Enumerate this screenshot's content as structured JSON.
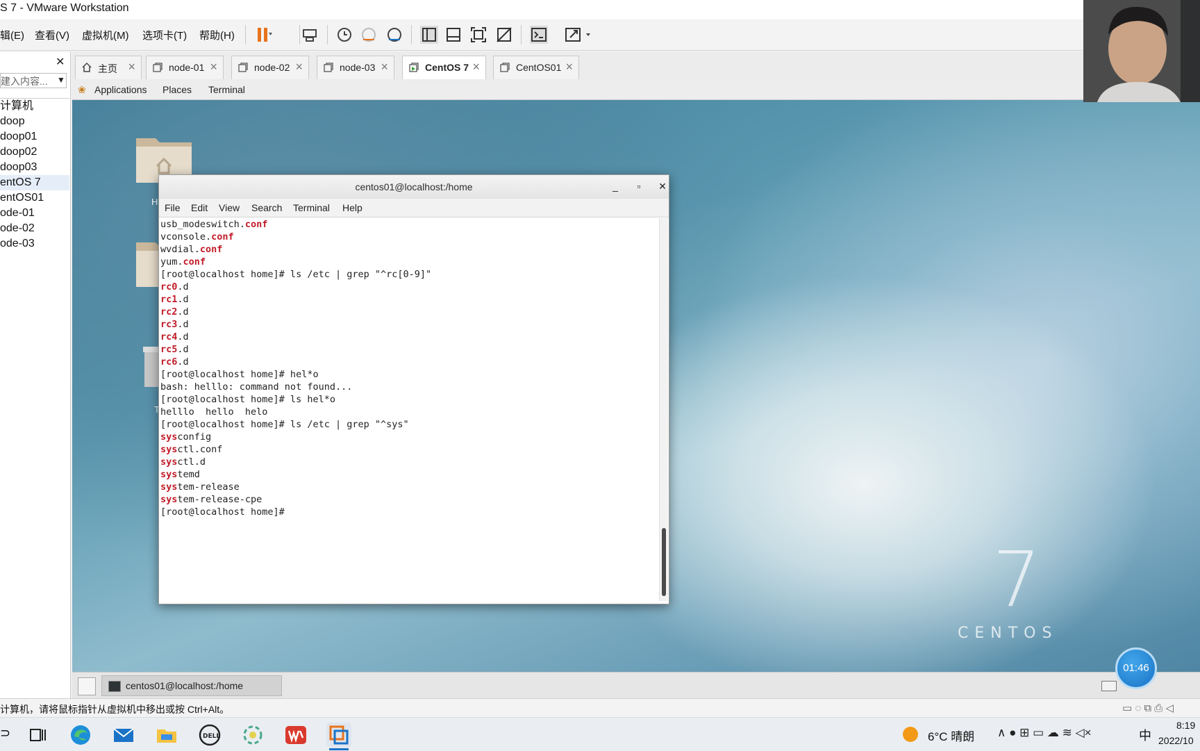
{
  "window": {
    "title": "S 7 - VMware Workstation"
  },
  "menu": [
    {
      "label": "辑(E)"
    },
    {
      "label": "查看(V)"
    },
    {
      "label": "虚拟机(M)"
    },
    {
      "label": "选项卡(T)"
    },
    {
      "label": "帮助(H)"
    }
  ],
  "toolbar": {
    "icons": [
      "pause-icon",
      "send-ctrl-alt-del-icon",
      "snapshot-icon",
      "revert-snapshot-icon",
      "snapshot-manager-icon",
      "library-view-icon",
      "thumbnail-bar-icon",
      "full-screen-icon",
      "unity-icon",
      "console-view-icon",
      "stretch-guest-icon"
    ]
  },
  "library": {
    "close": "✕",
    "search_placeholder": "建入内容...",
    "items": [
      {
        "label": "计算机",
        "selected": false
      },
      {
        "label": "doop",
        "selected": false
      },
      {
        "label": "doop01",
        "selected": false
      },
      {
        "label": "doop02",
        "selected": false
      },
      {
        "label": "doop03",
        "selected": false
      },
      {
        "label": "entOS 7",
        "selected": true
      },
      {
        "label": "entOS01",
        "selected": false
      },
      {
        "label": "ode-01",
        "selected": false
      },
      {
        "label": "ode-02",
        "selected": false
      },
      {
        "label": "ode-03",
        "selected": false
      }
    ]
  },
  "tabs": [
    {
      "label": "主页",
      "icon": "home-icon",
      "active": false
    },
    {
      "label": "node-01",
      "icon": "vm-icon",
      "active": false
    },
    {
      "label": "node-02",
      "icon": "vm-icon",
      "active": false
    },
    {
      "label": "node-03",
      "icon": "vm-icon",
      "active": false
    },
    {
      "label": "CentOS 7",
      "icon": "vm-running-icon",
      "active": true
    },
    {
      "label": "CentOS01",
      "icon": "vm-icon",
      "active": false
    }
  ],
  "guest": {
    "topbar": {
      "applications": "Applications",
      "places": "Places",
      "terminal": "Terminal"
    },
    "desktop_labels": [
      "H",
      "T"
    ],
    "terminal": {
      "title": "centos01@localhost:/home",
      "menu": [
        "File",
        "Edit",
        "View",
        "Search",
        "Terminal",
        "Help"
      ],
      "lines": [
        [
          {
            "t": "usb_modeswitch."
          },
          {
            "t": "conf",
            "hl": true
          }
        ],
        [
          {
            "t": "vconsole."
          },
          {
            "t": "conf",
            "hl": true
          }
        ],
        [
          {
            "t": "wvdial."
          },
          {
            "t": "conf",
            "hl": true
          }
        ],
        [
          {
            "t": "yum."
          },
          {
            "t": "conf",
            "hl": true
          }
        ],
        [
          {
            "t": "[root@localhost home]# ls /etc | grep \"^rc[0-9]\""
          }
        ],
        [
          {
            "t": "rc0",
            "hl": true
          },
          {
            "t": ".d"
          }
        ],
        [
          {
            "t": "rc1",
            "hl": true
          },
          {
            "t": ".d"
          }
        ],
        [
          {
            "t": "rc2",
            "hl": true
          },
          {
            "t": ".d"
          }
        ],
        [
          {
            "t": "rc3",
            "hl": true
          },
          {
            "t": ".d"
          }
        ],
        [
          {
            "t": "rc4",
            "hl": true
          },
          {
            "t": ".d"
          }
        ],
        [
          {
            "t": "rc5",
            "hl": true
          },
          {
            "t": ".d"
          }
        ],
        [
          {
            "t": "rc6",
            "hl": true
          },
          {
            "t": ".d"
          }
        ],
        [
          {
            "t": "[root@localhost home]# hel*o"
          }
        ],
        [
          {
            "t": "bash: helllo: command not found..."
          }
        ],
        [
          {
            "t": "[root@localhost home]# ls hel*o"
          }
        ],
        [
          {
            "t": "helllo  hello  helo"
          }
        ],
        [
          {
            "t": "[root@localhost home]# ls /etc | grep \"^sys\""
          }
        ],
        [
          {
            "t": "sys",
            "hl": true
          },
          {
            "t": "config"
          }
        ],
        [
          {
            "t": "sys",
            "hl": true
          },
          {
            "t": "ctl.conf"
          }
        ],
        [
          {
            "t": "sys",
            "hl": true
          },
          {
            "t": "ctl.d"
          }
        ],
        [
          {
            "t": "sys",
            "hl": true
          },
          {
            "t": "temd"
          }
        ],
        [
          {
            "t": "sys",
            "hl": true
          },
          {
            "t": "tem-release"
          }
        ],
        [
          {
            "t": "sys",
            "hl": true
          },
          {
            "t": "tem-release-cpe"
          }
        ],
        [
          {
            "t": "[root@localhost home]# "
          }
        ]
      ],
      "scroll_position": 0.92
    },
    "brand": {
      "number": "7",
      "word": "CENTOS"
    },
    "taskbar_item": "centos01@localhost:/home"
  },
  "status": {
    "message": "计算机，请将鼠标指针从虚拟机中移出或按 Ctrl+Alt。"
  },
  "recording": {
    "time": "01:46"
  },
  "wintaskbar": {
    "apps": [
      "task-view-icon",
      "edge-icon",
      "mail-icon",
      "file-explorer-icon",
      "dell-icon",
      "pinwheel-icon",
      "wps-icon",
      "vmware-icon"
    ],
    "weather": "6°C 晴朗",
    "ime": "中",
    "time": "8:19",
    "date": "2022/10"
  },
  "colors": {
    "highlight": "#c01c28",
    "accent": "#1a73c7"
  }
}
